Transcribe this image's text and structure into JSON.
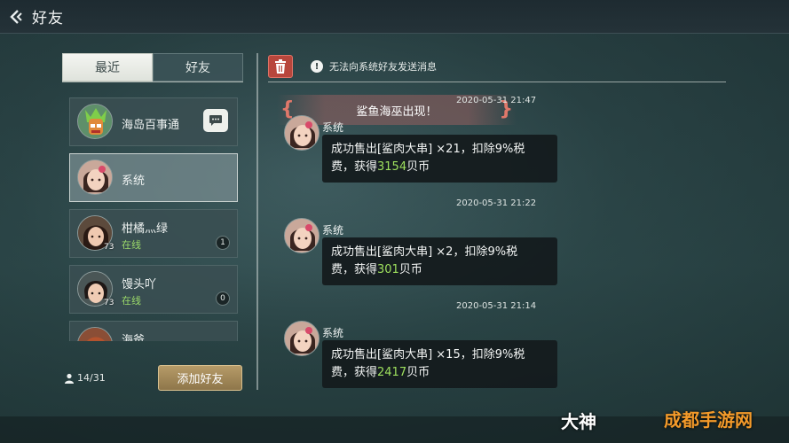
{
  "header": {
    "title": "好友"
  },
  "left": {
    "tabs": [
      {
        "label": "最近",
        "active": true
      },
      {
        "label": "好友",
        "active": false
      }
    ],
    "friends": [
      {
        "name": "海岛百事通",
        "type": "npc"
      },
      {
        "name": "系统",
        "type": "system",
        "selected": true
      },
      {
        "name": "柑橘灬绿",
        "status": "在线",
        "level": "73",
        "badge": "1"
      },
      {
        "name": "馒头吖",
        "status": "在线",
        "level": "73",
        "badge": "0"
      },
      {
        "name": "海爸"
      }
    ],
    "friend_count": "14/31",
    "add_friend_label": "添加好友"
  },
  "chat": {
    "notice": "无法向系统好友发送消息",
    "banner": "鲨鱼海巫出现！",
    "messages": [
      {
        "time": "2020-05-31  21:47",
        "sender": "系统",
        "line1": "成功售出[鲨肉大串] ×21，扣除9%税",
        "line2_pre": "费，获得",
        "amount": "3154",
        "line2_post": "贝币"
      },
      {
        "time": "2020-05-31  21:22",
        "sender": "系统",
        "line1": "成功售出[鲨肉大串] ×2，扣除9%税",
        "line2_pre": "费，获得",
        "amount": "301",
        "line2_post": "贝币"
      },
      {
        "time": "2020-05-31  21:14",
        "sender": "系统",
        "line1": "成功售出[鲨肉大串] ×15，扣除9%税",
        "line2_pre": "费，获得",
        "amount": "2417",
        "line2_post": "贝币"
      }
    ]
  },
  "watermark": {
    "left": "大神",
    "right": "成都手游网"
  },
  "colors": {
    "highlight": "#9ee05e",
    "add_button": "#a88c5a",
    "delete_button": "#b8463c"
  }
}
